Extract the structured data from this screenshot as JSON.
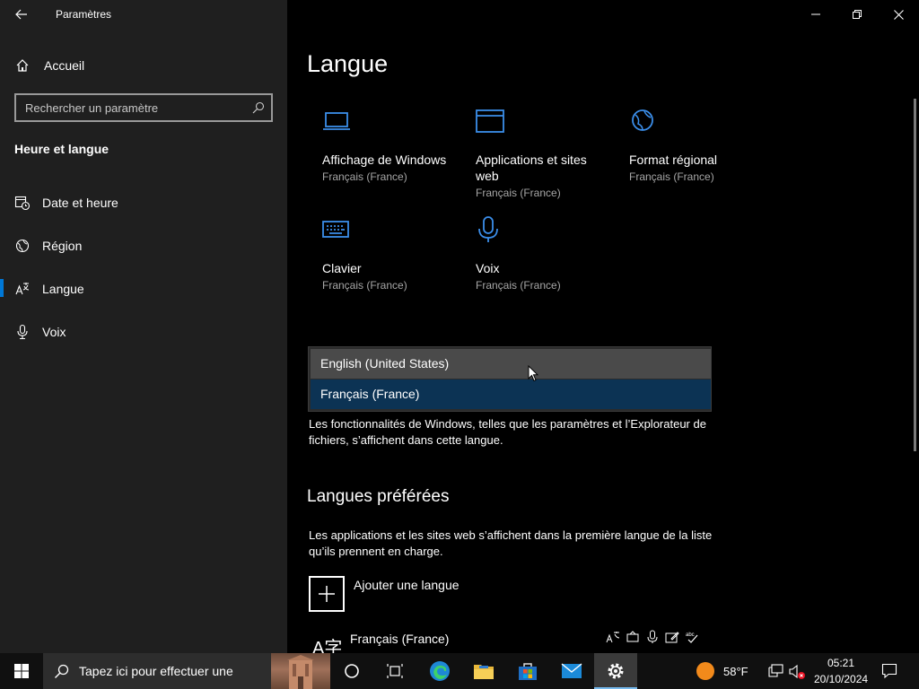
{
  "window": {
    "app_title": "Paramètres"
  },
  "sidebar": {
    "home_label": "Accueil",
    "search_placeholder": "Rechercher un paramètre",
    "section_title": "Heure et langue",
    "items": [
      {
        "label": "Date et heure",
        "icon": "calendar-clock-icon"
      },
      {
        "label": "Région",
        "icon": "globe-region-icon"
      },
      {
        "label": "Langue",
        "icon": "language-icon",
        "selected": true
      },
      {
        "label": "Voix",
        "icon": "microphone-icon"
      }
    ]
  },
  "main": {
    "title": "Langue",
    "tiles": [
      {
        "name": "Affichage de Windows",
        "sub": "Français (France)",
        "icon": "laptop-icon"
      },
      {
        "name": "Applications et sites web",
        "sub": "Français (France)",
        "icon": "window-icon"
      },
      {
        "name": "Format régional",
        "sub": "Français (France)",
        "icon": "globe-icon"
      },
      {
        "name": "Clavier",
        "sub": "Français (France)",
        "icon": "keyboard-icon"
      },
      {
        "name": "Voix",
        "sub": "Français (France)",
        "icon": "microphone-icon"
      }
    ],
    "dropdown_options": [
      "English (United States)",
      "Français (France)"
    ],
    "dropdown_selected": "Français (France)",
    "display_language_desc": "Les fonctionnalités de Windows, telles que les paramètres et l’Explorateur de fichiers, s’affichent dans cette langue.",
    "preferred_title": "Langues préférées",
    "preferred_desc": "Les applications et les sites web s’affichent dans la première langue de la liste qu’ils prennent en charge.",
    "add_language_label": "Ajouter une langue",
    "language_entry": "Français (France)",
    "language_glyph": "A字"
  },
  "taskbar": {
    "search_placeholder": "Tapez ici pour effectuer une",
    "weather": "58°F",
    "time": "05:21",
    "date": "20/10/2024"
  },
  "colors": {
    "accent": "#0078d7",
    "selected_option": "#0c3354",
    "sidebar_bg": "#1f1f1f",
    "icon_blue": "#3b8eea"
  }
}
